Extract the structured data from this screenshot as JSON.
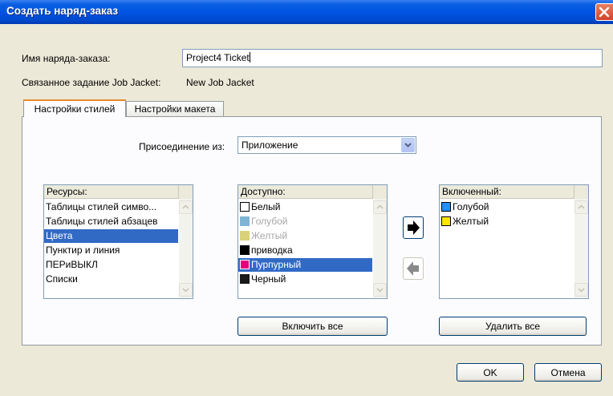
{
  "window": {
    "title": "Создать наряд-заказ"
  },
  "ticket_name": {
    "label": "Имя наряда-заказа:",
    "value": "Project4 Ticket"
  },
  "linked_job": {
    "label": "Связанное задание Job Jacket:",
    "value": "New Job Jacket"
  },
  "tabs": [
    {
      "label": "Настройки стилей",
      "active": true
    },
    {
      "label": "Настройки макета",
      "active": false
    }
  ],
  "append_from": {
    "label": "Присоединение из:",
    "selected": "Приложение"
  },
  "resources": {
    "header": "Ресурсы:",
    "items": [
      "Таблицы стилей симво...",
      "Таблицы стилей абзацев",
      "Цвета",
      "Пунктир и линия",
      "ПЕРиВЫКЛ",
      "Списки"
    ],
    "selected_index": 2
  },
  "available": {
    "header": "Доступно:",
    "items": [
      {
        "label": "Белый",
        "color": "#ffffff",
        "enabled": true
      },
      {
        "label": "Голубой",
        "color": "#7fb4d4",
        "enabled": false
      },
      {
        "label": "Желтый",
        "color": "#d9d27a",
        "enabled": false
      },
      {
        "label": "приводка",
        "color": "#000000",
        "enabled": true
      },
      {
        "label": "Пурпурный",
        "color": "#e4007c",
        "enabled": true,
        "selected": true
      },
      {
        "label": "Черный",
        "color": "#1a1a1a",
        "enabled": true
      }
    ],
    "include_all_label": "Включить все"
  },
  "included": {
    "header": "Включенный:",
    "items": [
      {
        "label": "Голубой",
        "color": "#1e90ff"
      },
      {
        "label": "Желтый",
        "color": "#ffe600"
      }
    ],
    "remove_all_label": "Удалить все"
  },
  "buttons": {
    "ok": "OK",
    "cancel": "Отмена"
  }
}
